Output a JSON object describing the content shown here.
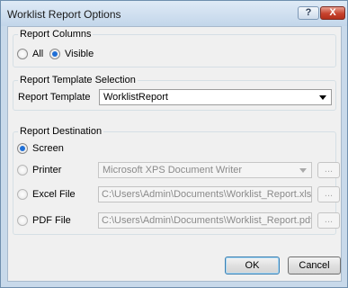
{
  "window": {
    "title": "Worklist Report Options",
    "help_label": "?",
    "close_label": "X"
  },
  "report_columns": {
    "title": "Report Columns",
    "options": [
      {
        "label": "All",
        "selected": false
      },
      {
        "label": "Visible",
        "selected": true
      }
    ]
  },
  "template_selection": {
    "title": "Report Template Selection",
    "label": "Report Template",
    "value": "WorklistReport"
  },
  "destination": {
    "title": "Report Destination",
    "screen_label": "Screen",
    "printer_label": "Printer",
    "printer_value": "Microsoft XPS Document Writer",
    "excel_label": "Excel File",
    "excel_path": "C:\\Users\\Admin\\Documents\\Worklist_Report.xls",
    "pdf_label": "PDF File",
    "pdf_path": "C:\\Users\\Admin\\Documents\\Worklist_Report.pdf",
    "browse_label": "...",
    "selected": "Screen"
  },
  "buttons": {
    "ok": "OK",
    "cancel": "Cancel"
  }
}
